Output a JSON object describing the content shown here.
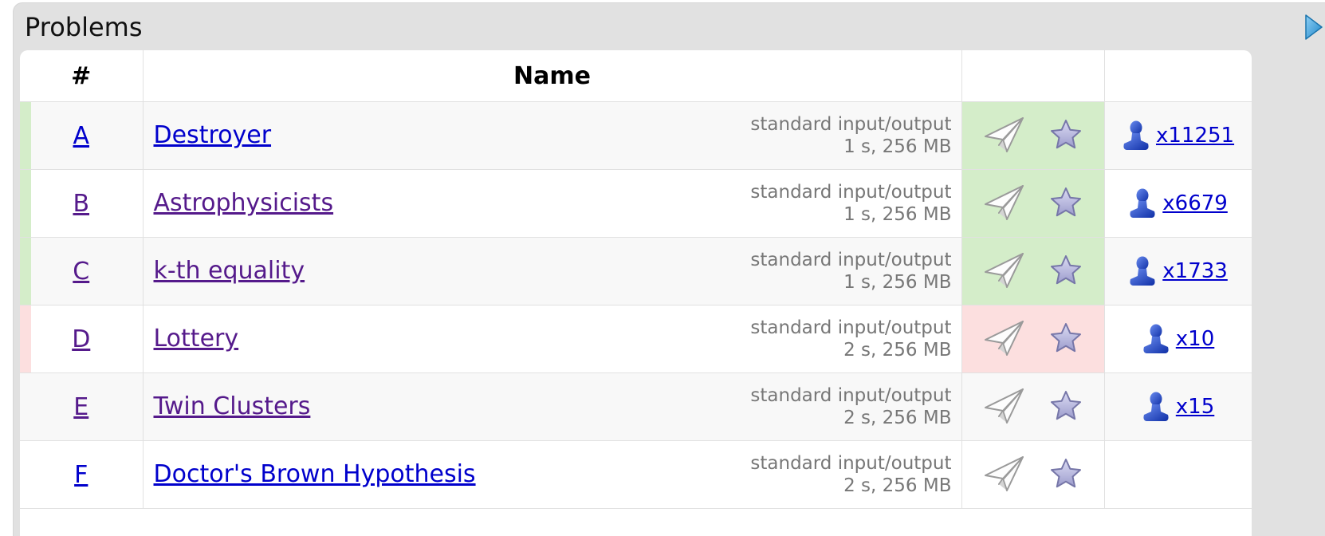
{
  "panel": {
    "title": "Problems",
    "toggle_icon": "play-arrow-icon"
  },
  "table": {
    "col_index": "#",
    "col_name": "Name"
  },
  "colors": {
    "accepted": "#d4edc9",
    "rejected": "#fcdfdf",
    "link": "#0000cc",
    "visited_link": "#551a8b"
  },
  "problems": [
    {
      "index": "A",
      "name": "Destroyer",
      "io": "standard input/output",
      "limits": "1 s, 256 MB",
      "status": "accepted",
      "solved": "x11251",
      "visited": false
    },
    {
      "index": "B",
      "name": "Astrophysicists",
      "io": "standard input/output",
      "limits": "1 s, 256 MB",
      "status": "accepted",
      "solved": "x6679",
      "visited": true
    },
    {
      "index": "C",
      "name": "k-th equality",
      "io": "standard input/output",
      "limits": "1 s, 256 MB",
      "status": "accepted",
      "solved": "x1733",
      "visited": true
    },
    {
      "index": "D",
      "name": "Lottery",
      "io": "standard input/output",
      "limits": "2 s, 256 MB",
      "status": "rejected",
      "solved": "x10",
      "visited": true
    },
    {
      "index": "E",
      "name": "Twin Clusters",
      "io": "standard input/output",
      "limits": "2 s, 256 MB",
      "status": "none",
      "solved": "x15",
      "visited": true
    },
    {
      "index": "F",
      "name": "Doctor's Brown Hypothesis",
      "io": "standard input/output",
      "limits": "2 s, 256 MB",
      "status": "none",
      "solved": "",
      "visited": false
    }
  ]
}
